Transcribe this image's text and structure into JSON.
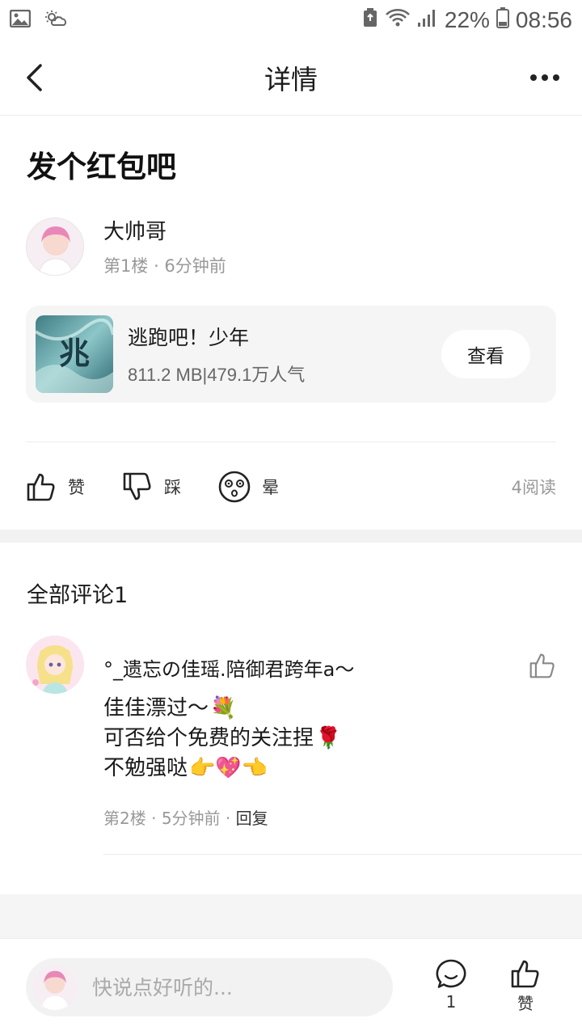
{
  "status_bar": {
    "battery_percent": "22%",
    "time": "08:56",
    "icons": [
      "gallery-icon",
      "weather-icon",
      "battery-saver-icon",
      "wifi-icon",
      "signal-icon",
      "battery-icon"
    ]
  },
  "nav": {
    "title": "详情",
    "back_icon": "chevron-left-icon",
    "more_icon": "more-dots-icon"
  },
  "post": {
    "title": "发个红包吧",
    "author": {
      "name": "大帅哥",
      "floor": "第1楼",
      "time": "6分钟前"
    },
    "app_card": {
      "name": "逃跑吧！少年",
      "meta": "811.2 MB|479.1万人气",
      "icon_text": "兆",
      "button_label": "查看"
    },
    "actions": {
      "like_label": "赞",
      "dislike_label": "踩",
      "dizzy_label": "晕",
      "read_count": "4阅读"
    }
  },
  "comments": {
    "header": "全部评论1",
    "items": [
      {
        "author": "°_遗忘の佳瑶.陪御君跨年a～",
        "lines": [
          {
            "text": "佳佳漂过～",
            "emoji": "💐"
          },
          {
            "text": "可否给个免费的关注捏",
            "emoji": "🌹"
          },
          {
            "text": "不勉强哒",
            "emoji": "👉💖👈"
          }
        ],
        "floor": "第2楼",
        "time": "5分钟前",
        "reply_label": "回复"
      }
    ]
  },
  "bottom_bar": {
    "input_placeholder": "快说点好听的...",
    "comment_count": "1",
    "like_label": "赞"
  },
  "colors": {
    "text_primary": "#1a1a1a",
    "text_secondary": "#999999",
    "card_bg": "#f5f5f5",
    "divider": "#ececec"
  }
}
